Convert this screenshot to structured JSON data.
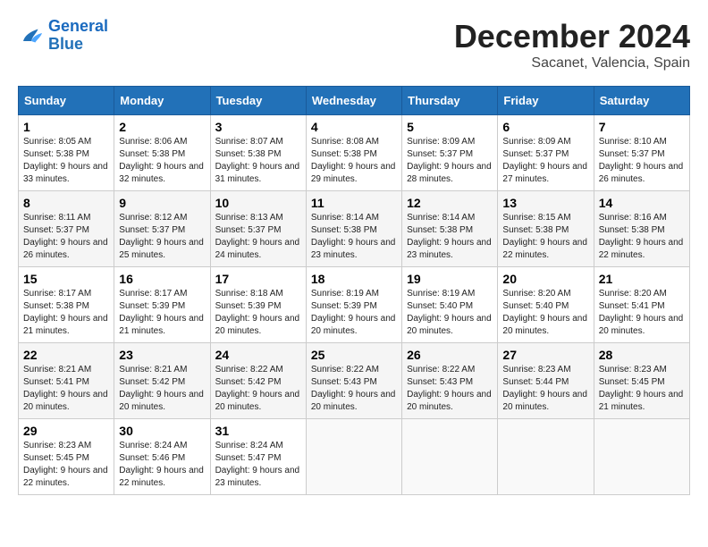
{
  "header": {
    "logo_line1": "General",
    "logo_line2": "Blue",
    "month_title": "December 2024",
    "subtitle": "Sacanet, Valencia, Spain"
  },
  "weekdays": [
    "Sunday",
    "Monday",
    "Tuesday",
    "Wednesday",
    "Thursday",
    "Friday",
    "Saturday"
  ],
  "weeks": [
    [
      {
        "day": "1",
        "sunrise": "Sunrise: 8:05 AM",
        "sunset": "Sunset: 5:38 PM",
        "daylight": "Daylight: 9 hours and 33 minutes."
      },
      {
        "day": "2",
        "sunrise": "Sunrise: 8:06 AM",
        "sunset": "Sunset: 5:38 PM",
        "daylight": "Daylight: 9 hours and 32 minutes."
      },
      {
        "day": "3",
        "sunrise": "Sunrise: 8:07 AM",
        "sunset": "Sunset: 5:38 PM",
        "daylight": "Daylight: 9 hours and 31 minutes."
      },
      {
        "day": "4",
        "sunrise": "Sunrise: 8:08 AM",
        "sunset": "Sunset: 5:38 PM",
        "daylight": "Daylight: 9 hours and 29 minutes."
      },
      {
        "day": "5",
        "sunrise": "Sunrise: 8:09 AM",
        "sunset": "Sunset: 5:37 PM",
        "daylight": "Daylight: 9 hours and 28 minutes."
      },
      {
        "day": "6",
        "sunrise": "Sunrise: 8:09 AM",
        "sunset": "Sunset: 5:37 PM",
        "daylight": "Daylight: 9 hours and 27 minutes."
      },
      {
        "day": "7",
        "sunrise": "Sunrise: 8:10 AM",
        "sunset": "Sunset: 5:37 PM",
        "daylight": "Daylight: 9 hours and 26 minutes."
      }
    ],
    [
      {
        "day": "8",
        "sunrise": "Sunrise: 8:11 AM",
        "sunset": "Sunset: 5:37 PM",
        "daylight": "Daylight: 9 hours and 26 minutes."
      },
      {
        "day": "9",
        "sunrise": "Sunrise: 8:12 AM",
        "sunset": "Sunset: 5:37 PM",
        "daylight": "Daylight: 9 hours and 25 minutes."
      },
      {
        "day": "10",
        "sunrise": "Sunrise: 8:13 AM",
        "sunset": "Sunset: 5:37 PM",
        "daylight": "Daylight: 9 hours and 24 minutes."
      },
      {
        "day": "11",
        "sunrise": "Sunrise: 8:14 AM",
        "sunset": "Sunset: 5:38 PM",
        "daylight": "Daylight: 9 hours and 23 minutes."
      },
      {
        "day": "12",
        "sunrise": "Sunrise: 8:14 AM",
        "sunset": "Sunset: 5:38 PM",
        "daylight": "Daylight: 9 hours and 23 minutes."
      },
      {
        "day": "13",
        "sunrise": "Sunrise: 8:15 AM",
        "sunset": "Sunset: 5:38 PM",
        "daylight": "Daylight: 9 hours and 22 minutes."
      },
      {
        "day": "14",
        "sunrise": "Sunrise: 8:16 AM",
        "sunset": "Sunset: 5:38 PM",
        "daylight": "Daylight: 9 hours and 22 minutes."
      }
    ],
    [
      {
        "day": "15",
        "sunrise": "Sunrise: 8:17 AM",
        "sunset": "Sunset: 5:38 PM",
        "daylight": "Daylight: 9 hours and 21 minutes."
      },
      {
        "day": "16",
        "sunrise": "Sunrise: 8:17 AM",
        "sunset": "Sunset: 5:39 PM",
        "daylight": "Daylight: 9 hours and 21 minutes."
      },
      {
        "day": "17",
        "sunrise": "Sunrise: 8:18 AM",
        "sunset": "Sunset: 5:39 PM",
        "daylight": "Daylight: 9 hours and 20 minutes."
      },
      {
        "day": "18",
        "sunrise": "Sunrise: 8:19 AM",
        "sunset": "Sunset: 5:39 PM",
        "daylight": "Daylight: 9 hours and 20 minutes."
      },
      {
        "day": "19",
        "sunrise": "Sunrise: 8:19 AM",
        "sunset": "Sunset: 5:40 PM",
        "daylight": "Daylight: 9 hours and 20 minutes."
      },
      {
        "day": "20",
        "sunrise": "Sunrise: 8:20 AM",
        "sunset": "Sunset: 5:40 PM",
        "daylight": "Daylight: 9 hours and 20 minutes."
      },
      {
        "day": "21",
        "sunrise": "Sunrise: 8:20 AM",
        "sunset": "Sunset: 5:41 PM",
        "daylight": "Daylight: 9 hours and 20 minutes."
      }
    ],
    [
      {
        "day": "22",
        "sunrise": "Sunrise: 8:21 AM",
        "sunset": "Sunset: 5:41 PM",
        "daylight": "Daylight: 9 hours and 20 minutes."
      },
      {
        "day": "23",
        "sunrise": "Sunrise: 8:21 AM",
        "sunset": "Sunset: 5:42 PM",
        "daylight": "Daylight: 9 hours and 20 minutes."
      },
      {
        "day": "24",
        "sunrise": "Sunrise: 8:22 AM",
        "sunset": "Sunset: 5:42 PM",
        "daylight": "Daylight: 9 hours and 20 minutes."
      },
      {
        "day": "25",
        "sunrise": "Sunrise: 8:22 AM",
        "sunset": "Sunset: 5:43 PM",
        "daylight": "Daylight: 9 hours and 20 minutes."
      },
      {
        "day": "26",
        "sunrise": "Sunrise: 8:22 AM",
        "sunset": "Sunset: 5:43 PM",
        "daylight": "Daylight: 9 hours and 20 minutes."
      },
      {
        "day": "27",
        "sunrise": "Sunrise: 8:23 AM",
        "sunset": "Sunset: 5:44 PM",
        "daylight": "Daylight: 9 hours and 20 minutes."
      },
      {
        "day": "28",
        "sunrise": "Sunrise: 8:23 AM",
        "sunset": "Sunset: 5:45 PM",
        "daylight": "Daylight: 9 hours and 21 minutes."
      }
    ],
    [
      {
        "day": "29",
        "sunrise": "Sunrise: 8:23 AM",
        "sunset": "Sunset: 5:45 PM",
        "daylight": "Daylight: 9 hours and 22 minutes."
      },
      {
        "day": "30",
        "sunrise": "Sunrise: 8:24 AM",
        "sunset": "Sunset: 5:46 PM",
        "daylight": "Daylight: 9 hours and 22 minutes."
      },
      {
        "day": "31",
        "sunrise": "Sunrise: 8:24 AM",
        "sunset": "Sunset: 5:47 PM",
        "daylight": "Daylight: 9 hours and 23 minutes."
      },
      null,
      null,
      null,
      null
    ]
  ]
}
